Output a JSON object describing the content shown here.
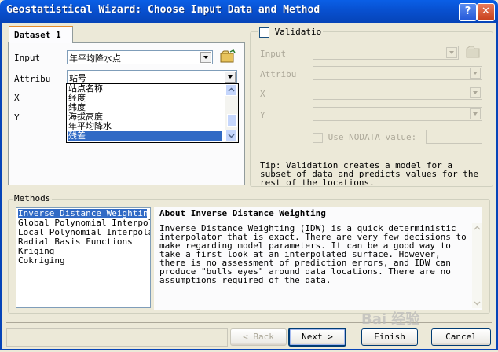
{
  "window": {
    "title": "Geostatistical Wizard: Choose Input Data and Method",
    "help_label": "?",
    "close_label": "✕"
  },
  "tabs": [
    {
      "label": "Dataset 1"
    }
  ],
  "dataset": {
    "input_label": "Input",
    "input_value": "年平均降水点",
    "attribute_label": "Attribu",
    "attribute_value": "站号",
    "x_label": "X",
    "y_label": "Y",
    "attribute_options": [
      "站点名称",
      "经度",
      "纬度",
      "海拔高度",
      "年平均降水",
      "残差"
    ],
    "attribute_highlighted": "残差"
  },
  "validation": {
    "label": "Validatio",
    "input_label": "Input",
    "attribute_label": "Attribu",
    "x_label": "X",
    "y_label": "Y",
    "nodata_label": "Use NODATA value:",
    "tip": "Tip:  Validation creates a model for a subset of data and predicts values for the rest of the locations."
  },
  "methods": {
    "label": "Methods",
    "items": [
      "Inverse Distance Weighting",
      "Global Polynomial Interpolat",
      "Local Polynomial Interpolati",
      "Radial Basis Functions",
      "Kriging",
      "Cokriging"
    ],
    "selected": "Inverse Distance Weighting",
    "description_title": "About Inverse Distance Weighting",
    "description": "Inverse Distance Weighting (IDW) is a quick deterministic interpolator that is exact. There are very few decisions to make regarding model parameters. It can be a good way to take a first look at an interpolated surface. However, there is no assessment of prediction errors, and IDW can produce \"bulls eyes\" around data locations. There are no assumptions required of the data."
  },
  "buttons": {
    "back": "< Back",
    "next": "Next >",
    "finish": "Finish",
    "cancel": "Cancel"
  },
  "watermark": "Bai 经验"
}
